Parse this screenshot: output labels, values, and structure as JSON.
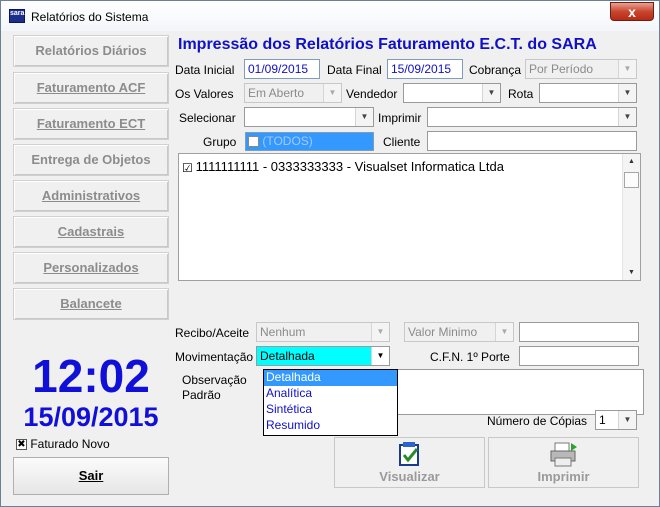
{
  "window": {
    "title": "Relatórios do Sistema",
    "close_glyph": "x",
    "icon_text": "sara"
  },
  "sidebar": {
    "items": [
      {
        "label": "Relatórios Diários"
      },
      {
        "label": "Faturamento ACF"
      },
      {
        "label": "Faturamento ECT"
      },
      {
        "label": "Entrega de Objetos"
      },
      {
        "label": "Administrativos"
      },
      {
        "label": "Cadastrais"
      },
      {
        "label": "Personalizados"
      },
      {
        "label": "Balancete"
      }
    ],
    "clock_time": "12:02",
    "clock_date": "15/09/2015",
    "faturado_novo_label": "Faturado Novo",
    "faturado_novo_checked": true,
    "check_glyph": "✖",
    "exit_label": "Sair"
  },
  "form": {
    "title": "Impressão dos Relatórios Faturamento E.C.T. do SARA",
    "data_inicial_label": "Data Inicial",
    "data_inicial_value": "01/09/2015",
    "data_final_label": "Data Final",
    "data_final_value": "15/09/2015",
    "cobranca_label": "Cobrança",
    "cobranca_value": "Por Período",
    "os_valores_label": "Os Valores",
    "os_valores_value": "Em Aberto",
    "vendedor_label": "Vendedor",
    "vendedor_value": "",
    "rota_label": "Rota",
    "rota_value": "",
    "selecionar_label": "Selecionar",
    "selecionar_value": "",
    "imprimir_label": "Imprimir",
    "imprimir_value": "",
    "grupo_label": "Grupo",
    "grupo_value": "(TODOS)",
    "cliente_label": "Cliente",
    "cliente_value": "",
    "client_list": [
      {
        "text": "1111111111 - 0333333333 - Visualset Informatica Ltda",
        "checked": true
      }
    ],
    "recibo_label": "Recibo/Aceite",
    "recibo_value": "Nenhum",
    "valor_minimo_value": "Valor Minimo",
    "valor_minimo_amount": "",
    "movimentacao_label": "Movimentação",
    "movimentacao_value": "Detalhada",
    "movimentacao_options": [
      "Detalhada",
      "Analítica",
      "Sintética",
      "Resumido"
    ],
    "cfn_label": "C.F.N. 1º Porte",
    "cfn_value": "",
    "observacao_label_1": "Observação",
    "observacao_label_2": "Padrão",
    "copias_label": "Número de Cópias",
    "copias_value": "1",
    "visualizar_label": "Visualizar",
    "imprimir_button_label": "Imprimir"
  },
  "colors": {
    "accent": "#1010c8",
    "selection": "#3399ff",
    "highlight_cyan": "#00ffff"
  }
}
